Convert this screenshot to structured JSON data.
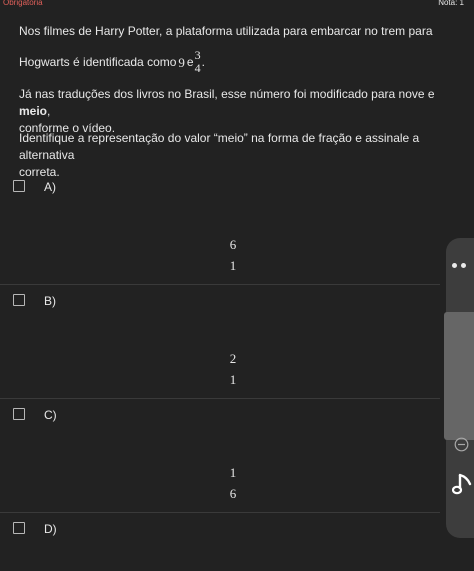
{
  "header": {
    "required_label": "Obrigatória",
    "grade_label": "Nota: 1"
  },
  "question": {
    "line1": "Nos filmes de Harry Potter, a plataforma utilizada para embarcar no trem para",
    "line2_prefix": "Hogwarts é identificada como",
    "line2_number": "9",
    "line2_and": "e",
    "line2_frac_num": "3",
    "line2_frac_den": "4",
    "line2_end": ".",
    "para2_a": "Já nas traduções dos livros no Brasil, esse número foi modificado para nove e ",
    "para2_bold": "meio",
    "para2_b": ",",
    "para2_line2": "conforme o vídeo.",
    "para3_line1": "Identifique a representação do valor “meio” na forma de fração e assinale a alternativa",
    "para3_line2": "correta."
  },
  "options": [
    {
      "label": "A)",
      "numerator": "6",
      "denominator": "1"
    },
    {
      "label": "B)",
      "numerator": "2",
      "denominator": "1"
    },
    {
      "label": "C)",
      "numerator": "1",
      "denominator": "6"
    },
    {
      "label": "D)"
    }
  ],
  "side_panel": {
    "icons": [
      "more-dots-icon",
      "minus-circle-icon",
      "music-note-icon"
    ]
  }
}
